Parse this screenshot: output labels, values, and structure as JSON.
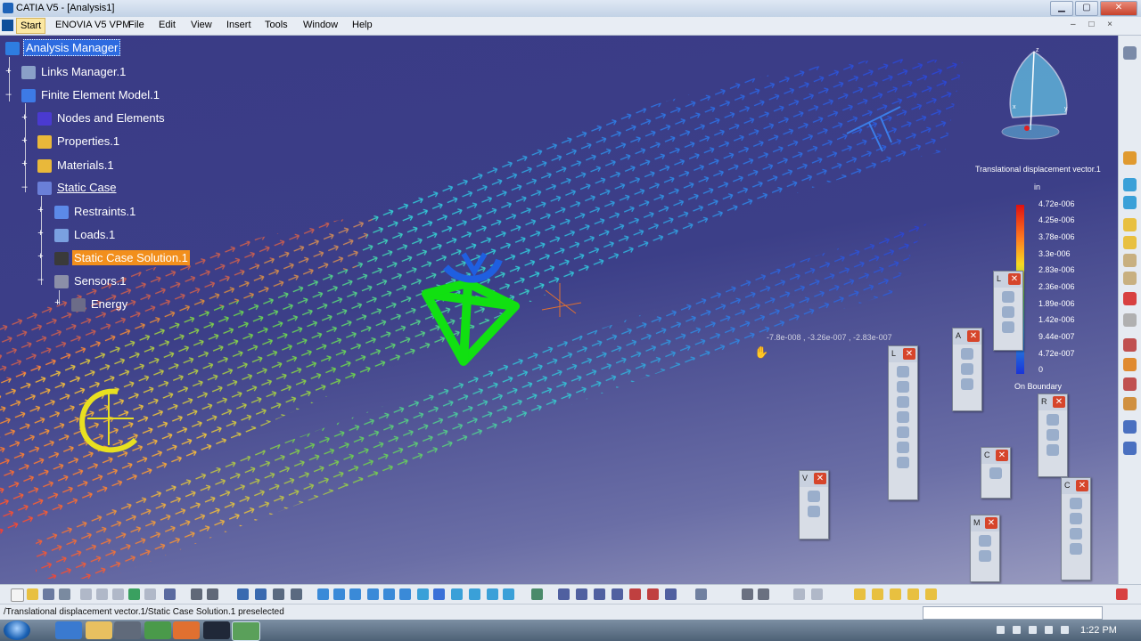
{
  "window": {
    "title": "CATIA V5 - [Analysis1]",
    "min": "▁",
    "max": "▢",
    "close": "✕"
  },
  "menu": {
    "start": "Start",
    "items": [
      "ENOVIA V5 VPM",
      "File",
      "Edit",
      "View",
      "Insert",
      "Tools",
      "Window",
      "Help"
    ]
  },
  "tree": {
    "analysis_manager": "Analysis Manager",
    "links_manager": "Links Manager.1",
    "fem": "Finite Element Model.1",
    "nodes": "Nodes and Elements",
    "properties": "Properties.1",
    "materials": "Materials.1",
    "static_case": "Static Case",
    "restraints": "Restraints.1",
    "loads": "Loads.1",
    "solution": "Static Case Solution.1",
    "sensors": "Sensors.1",
    "energy": "Energy"
  },
  "legend": {
    "title": "Translational displacement vector.1",
    "unit": "in",
    "values": [
      "4.72e-006",
      "4.25e-006",
      "3.78e-006",
      "3.3e-006",
      "2.83e-006",
      "2.36e-006",
      "1.89e-006",
      "1.42e-006",
      "9.44e-007",
      "4.72e-007",
      "0"
    ],
    "footer": "On Boundary"
  },
  "coordinate_readout": "-7.8e-008 , -3.26e-007 , -2.83e-007",
  "floating_toolbars": [
    {
      "label": "L",
      "x": "✕"
    },
    {
      "label": "A",
      "x": "✕"
    },
    {
      "label": "L",
      "x": "✕"
    },
    {
      "label": "R",
      "x": "✕"
    },
    {
      "label": "C",
      "x": "✕"
    },
    {
      "label": "V",
      "x": "✕"
    },
    {
      "label": "M",
      "x": "✕"
    },
    {
      "label": "C",
      "x": "✕"
    }
  ],
  "status": {
    "text": "/Translational displacement vector.1/Static Case Solution.1 preselected"
  },
  "taskbar": {
    "time": "1:22 PM"
  },
  "colors": {
    "selected": "#2d6be0",
    "highlight": "#f28f1c",
    "cursor_shape": "#00e000",
    "axis_blue": "#1f5fe0",
    "yellow_marker": "#e8e020"
  },
  "icons": [
    "search-icon",
    "gear-icon",
    "close-icon",
    "expand-icon",
    "cursor-hand-icon",
    "compass-icon"
  ]
}
